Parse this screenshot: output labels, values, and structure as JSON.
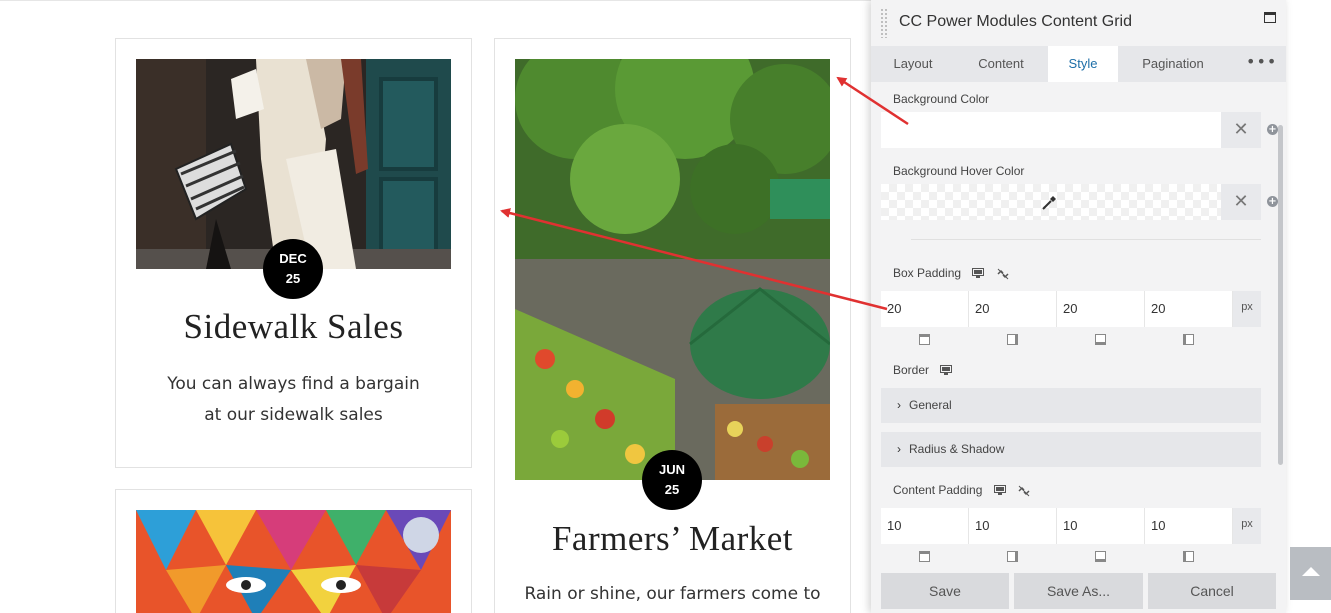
{
  "cards": [
    {
      "month": "DEC",
      "day": "25",
      "title": "Sidewalk Sales",
      "description": "You can always find a bargain at our sidewalk sales"
    },
    {
      "month": "JUN",
      "day": "25",
      "title": "Farmers’ Market",
      "description": "Rain or shine, our farmers come to"
    }
  ],
  "panel": {
    "title": "CC Power Modules Content Grid",
    "tabs": [
      {
        "label": "Layout",
        "active": false
      },
      {
        "label": "Content",
        "active": false
      },
      {
        "label": "Style",
        "active": true
      },
      {
        "label": "Pagination",
        "active": false
      }
    ],
    "more_label": "•••",
    "background_color_label": "Background Color",
    "background_hover_color_label": "Background Hover Color",
    "box_padding": {
      "label": "Box Padding",
      "values": [
        "20",
        "20",
        "20",
        "20"
      ],
      "unit": "px"
    },
    "border_label": "Border",
    "accordions": [
      "General",
      "Radius & Shadow"
    ],
    "content_padding": {
      "label": "Content Padding",
      "values": [
        "10",
        "10",
        "10",
        "10"
      ],
      "unit": "px"
    },
    "footer": {
      "save": "Save",
      "save_as": "Save As...",
      "cancel": "Cancel"
    }
  },
  "colors": {
    "accent": "#1e6fa8",
    "panel_bg": "#f3f3f4",
    "annotation_arrow": "#e03131"
  }
}
